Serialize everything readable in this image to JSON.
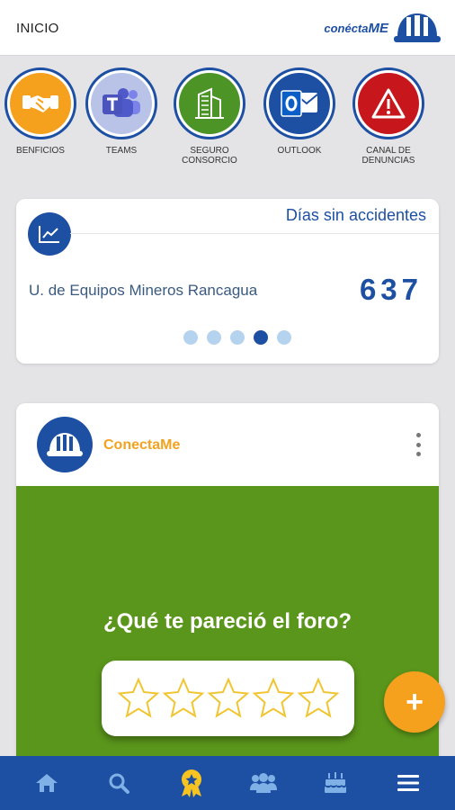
{
  "header": {
    "title": "INICIO",
    "brand": {
      "prefix": "conécta",
      "suffix": "ME",
      "color": "#1d4fa3"
    }
  },
  "shortcuts": [
    {
      "label": "BENFICIOS",
      "icon": "handshake-icon",
      "color": "#f6a11e"
    },
    {
      "label": "TEAMS",
      "icon": "teams-icon",
      "color": "#b9c3e8"
    },
    {
      "label": "SEGURO CONSORCIO",
      "icon": "building-icon",
      "color": "#4d9426"
    },
    {
      "label": "OUTLOOK",
      "icon": "outlook-icon",
      "color": "#1d4fa3"
    },
    {
      "label": "CANAL DE DENUNCIAS",
      "icon": "warning-icon",
      "color": "#c8161d"
    }
  ],
  "accidents": {
    "heading": "Días sin accidentes",
    "site": "U. de Equipos Mineros Rancagua",
    "count": "637",
    "pages": 5,
    "active_page": 4
  },
  "post": {
    "author": "ConectaMe",
    "question": "¿Qué te pareció el foro?",
    "rating_stars": 5,
    "media_color": "#5a961b"
  },
  "fab": {
    "label": "+"
  },
  "bottom_nav": [
    {
      "name": "home-icon",
      "active": false
    },
    {
      "name": "search-icon",
      "active": false
    },
    {
      "name": "award-icon",
      "active": true
    },
    {
      "name": "people-icon",
      "active": false
    },
    {
      "name": "cake-icon",
      "active": false
    },
    {
      "name": "menu-icon",
      "active": false
    }
  ],
  "colors": {
    "primary": "#1d4fa3",
    "accent": "#f6a11e",
    "background": "#e4e4e6"
  }
}
